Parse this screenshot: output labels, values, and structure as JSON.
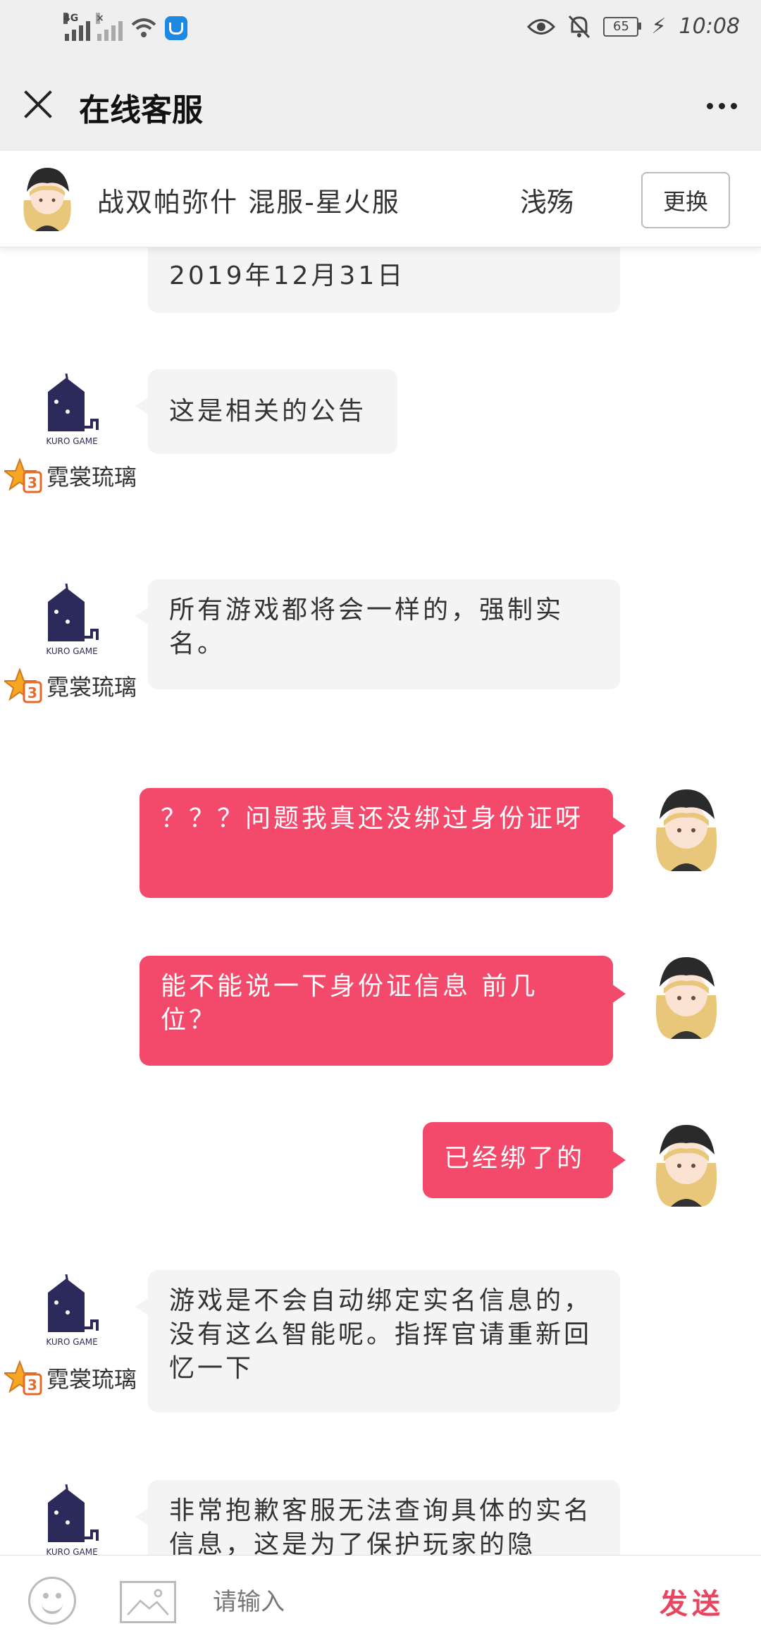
{
  "status_bar": {
    "network": "4G",
    "battery": "65",
    "time": "10:08"
  },
  "header": {
    "title": "在线客服"
  },
  "user_bar": {
    "name": "战双帕弥什  混服-星火服",
    "role": "浅殇",
    "change_label": "更换"
  },
  "messages": [
    {
      "from": "agent",
      "text": "2019年12月31日"
    },
    {
      "from": "agent",
      "text": "这是相关的公告",
      "agent_name": "霓裳琉璃"
    },
    {
      "from": "agent",
      "text": "所有游戏都将会一样的，强制实名。",
      "agent_name": "霓裳琉璃"
    },
    {
      "from": "user",
      "text": "？？？问题我真还没绑过身份证呀"
    },
    {
      "from": "user",
      "text": "能不能说一下身份证信息 前几位？"
    },
    {
      "from": "user",
      "text": "已经绑了的"
    },
    {
      "from": "agent",
      "text": "游戏是不会自动绑定实名信息的，没有这么智能呢。指挥官请重新回忆一下",
      "agent_name": "霓裳琉璃"
    },
    {
      "from": "agent",
      "text": "非常抱歉客服无法查询具体的实名信息，这是为了保护玩家的隐"
    }
  ],
  "agent_logo_text": "KURO GAME",
  "input": {
    "placeholder": "请输入",
    "send_label": "发送"
  },
  "colors": {
    "accent": "#f3496b",
    "send": "#e8465f",
    "header_bg": "#efefef"
  }
}
